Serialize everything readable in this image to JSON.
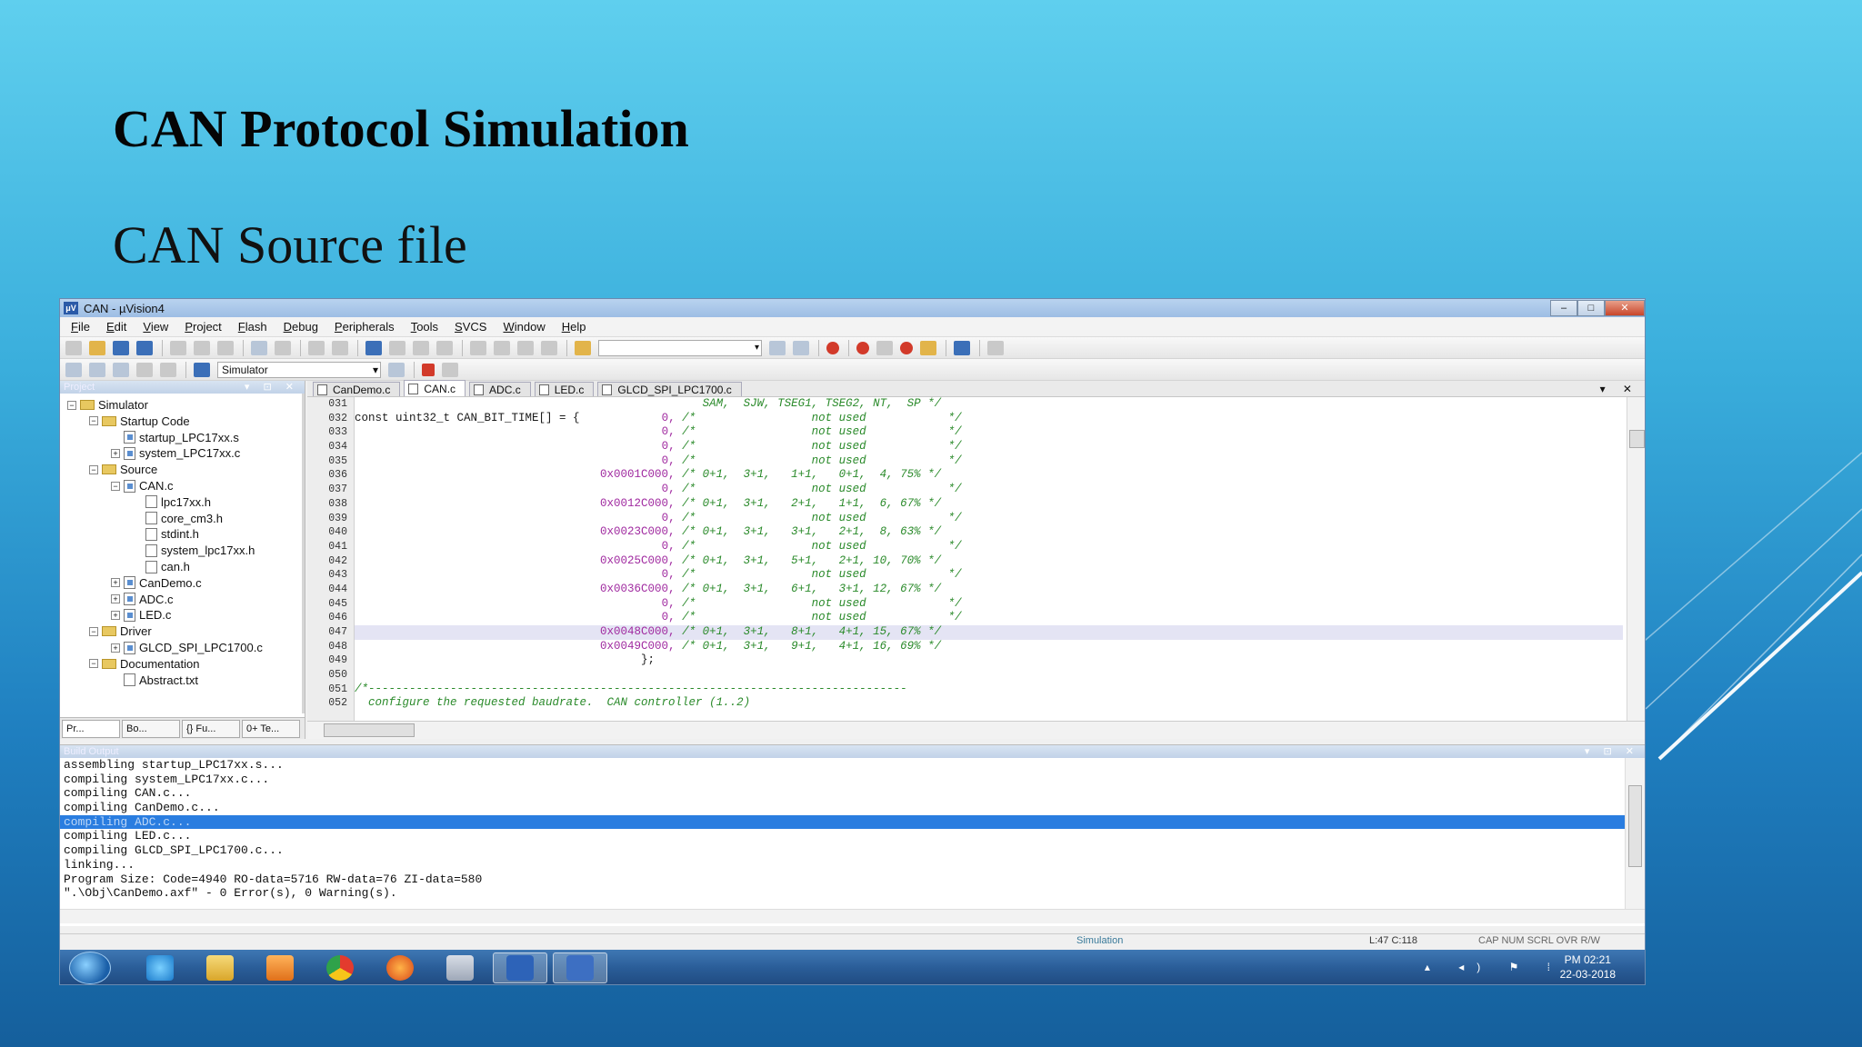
{
  "slide": {
    "title": "CAN Protocol Simulation",
    "subtitle": "CAN Source file"
  },
  "window": {
    "title": "CAN  - µVision4",
    "controls": [
      "–",
      "□",
      "✕"
    ]
  },
  "menu": [
    "File",
    "Edit",
    "View",
    "Project",
    "Flash",
    "Debug",
    "Peripherals",
    "Tools",
    "SVCS",
    "Window",
    "Help"
  ],
  "toolbar": {
    "target": "Simulator"
  },
  "project": {
    "panel_title": "Project",
    "tree": [
      {
        "label": "Simulator",
        "indent": 0,
        "kind": "target",
        "toggle": "−"
      },
      {
        "label": "Startup Code",
        "indent": 1,
        "kind": "folder",
        "toggle": "−"
      },
      {
        "label": "startup_LPC17xx.s",
        "indent": 2,
        "kind": "file",
        "toggle": ""
      },
      {
        "label": "system_LPC17xx.c",
        "indent": 2,
        "kind": "file",
        "toggle": "+"
      },
      {
        "label": "Source",
        "indent": 1,
        "kind": "folder",
        "toggle": "−"
      },
      {
        "label": "CAN.c",
        "indent": 2,
        "kind": "file",
        "toggle": "−"
      },
      {
        "label": "lpc17xx.h",
        "indent": 3,
        "kind": "header",
        "toggle": ""
      },
      {
        "label": "core_cm3.h",
        "indent": 3,
        "kind": "header",
        "toggle": ""
      },
      {
        "label": "stdint.h",
        "indent": 3,
        "kind": "header",
        "toggle": ""
      },
      {
        "label": "system_lpc17xx.h",
        "indent": 3,
        "kind": "header",
        "toggle": ""
      },
      {
        "label": "can.h",
        "indent": 3,
        "kind": "header",
        "toggle": ""
      },
      {
        "label": "CanDemo.c",
        "indent": 2,
        "kind": "file",
        "toggle": "+"
      },
      {
        "label": "ADC.c",
        "indent": 2,
        "kind": "file",
        "toggle": "+"
      },
      {
        "label": "LED.c",
        "indent": 2,
        "kind": "file",
        "toggle": "+"
      },
      {
        "label": "Driver",
        "indent": 1,
        "kind": "folder",
        "toggle": "−"
      },
      {
        "label": "GLCD_SPI_LPC1700.c",
        "indent": 2,
        "kind": "file",
        "toggle": "+"
      },
      {
        "label": "Documentation",
        "indent": 1,
        "kind": "folder",
        "toggle": "−"
      },
      {
        "label": "Abstract.txt",
        "indent": 2,
        "kind": "header",
        "toggle": ""
      }
    ],
    "tabs": [
      "Pr...",
      "Bo...",
      "{} Fu...",
      "0+ Te..."
    ]
  },
  "editor": {
    "tabs": [
      {
        "label": "CanDemo.c",
        "active": false
      },
      {
        "label": "CAN.c",
        "active": true
      },
      {
        "label": "ADC.c",
        "active": false
      },
      {
        "label": "LED.c",
        "active": false
      },
      {
        "label": "GLCD_SPI_LPC1700.c",
        "active": false
      }
    ],
    "lines": [
      {
        "n": "031",
        "parts": [
          {
            "t": "                                                   ",
            "c": "ck"
          },
          {
            "t": "SAM,  SJW, TSEG1, TSEG2, NT,  SP */",
            "c": "cc"
          }
        ]
      },
      {
        "n": "032",
        "parts": [
          {
            "t": "const uint32_t CAN_BIT_TIME[] = {            ",
            "c": "ck"
          },
          {
            "t": "0, ",
            "c": "cn"
          },
          {
            "t": "/*                 not used            */",
            "c": "cc"
          }
        ]
      },
      {
        "n": "033",
        "parts": [
          {
            "t": "                                             ",
            "c": "ck"
          },
          {
            "t": "0, ",
            "c": "cn"
          },
          {
            "t": "/*                 not used            */",
            "c": "cc"
          }
        ]
      },
      {
        "n": "034",
        "parts": [
          {
            "t": "                                             ",
            "c": "ck"
          },
          {
            "t": "0, ",
            "c": "cn"
          },
          {
            "t": "/*                 not used            */",
            "c": "cc"
          }
        ]
      },
      {
        "n": "035",
        "parts": [
          {
            "t": "                                             ",
            "c": "ck"
          },
          {
            "t": "0, ",
            "c": "cn"
          },
          {
            "t": "/*                 not used            */",
            "c": "cc"
          }
        ]
      },
      {
        "n": "036",
        "parts": [
          {
            "t": "                                    ",
            "c": "ck"
          },
          {
            "t": "0x0001C000, ",
            "c": "cn"
          },
          {
            "t": "/* 0+1,  3+1,   1+1,   0+1,  4, 75% */",
            "c": "cc"
          }
        ]
      },
      {
        "n": "037",
        "parts": [
          {
            "t": "                                             ",
            "c": "ck"
          },
          {
            "t": "0, ",
            "c": "cn"
          },
          {
            "t": "/*                 not used            */",
            "c": "cc"
          }
        ]
      },
      {
        "n": "038",
        "parts": [
          {
            "t": "                                    ",
            "c": "ck"
          },
          {
            "t": "0x0012C000, ",
            "c": "cn"
          },
          {
            "t": "/* 0+1,  3+1,   2+1,   1+1,  6, 67% */",
            "c": "cc"
          }
        ]
      },
      {
        "n": "039",
        "parts": [
          {
            "t": "                                             ",
            "c": "ck"
          },
          {
            "t": "0, ",
            "c": "cn"
          },
          {
            "t": "/*                 not used            */",
            "c": "cc"
          }
        ]
      },
      {
        "n": "040",
        "parts": [
          {
            "t": "                                    ",
            "c": "ck"
          },
          {
            "t": "0x0023C000, ",
            "c": "cn"
          },
          {
            "t": "/* 0+1,  3+1,   3+1,   2+1,  8, 63% */",
            "c": "cc"
          }
        ]
      },
      {
        "n": "041",
        "parts": [
          {
            "t": "                                             ",
            "c": "ck"
          },
          {
            "t": "0, ",
            "c": "cn"
          },
          {
            "t": "/*                 not used            */",
            "c": "cc"
          }
        ]
      },
      {
        "n": "042",
        "parts": [
          {
            "t": "                                    ",
            "c": "ck"
          },
          {
            "t": "0x0025C000, ",
            "c": "cn"
          },
          {
            "t": "/* 0+1,  3+1,   5+1,   2+1, 10, 70% */",
            "c": "cc"
          }
        ]
      },
      {
        "n": "043",
        "parts": [
          {
            "t": "                                             ",
            "c": "ck"
          },
          {
            "t": "0, ",
            "c": "cn"
          },
          {
            "t": "/*                 not used            */",
            "c": "cc"
          }
        ]
      },
      {
        "n": "044",
        "parts": [
          {
            "t": "                                    ",
            "c": "ck"
          },
          {
            "t": "0x0036C000, ",
            "c": "cn"
          },
          {
            "t": "/* 0+1,  3+1,   6+1,   3+1, 12, 67% */",
            "c": "cc"
          }
        ]
      },
      {
        "n": "045",
        "parts": [
          {
            "t": "                                             ",
            "c": "ck"
          },
          {
            "t": "0, ",
            "c": "cn"
          },
          {
            "t": "/*                 not used            */",
            "c": "cc"
          }
        ]
      },
      {
        "n": "046",
        "parts": [
          {
            "t": "                                             ",
            "c": "ck"
          },
          {
            "t": "0, ",
            "c": "cn"
          },
          {
            "t": "/*                 not used            */",
            "c": "cc"
          }
        ]
      },
      {
        "n": "047",
        "parts": [
          {
            "t": "                                    ",
            "c": "ck"
          },
          {
            "t": "0x0048C000, ",
            "c": "cn"
          },
          {
            "t": "/* 0+1,  3+1,   8+1,   4+1, 15, 67% */",
            "c": "cc"
          }
        ],
        "hl": true
      },
      {
        "n": "048",
        "parts": [
          {
            "t": "                                    ",
            "c": "ck"
          },
          {
            "t": "0x0049C000, ",
            "c": "cn"
          },
          {
            "t": "/* 0+1,  3+1,   9+1,   4+1, 16, 69% */",
            "c": "cc"
          }
        ]
      },
      {
        "n": "049",
        "parts": [
          {
            "t": "                                          };",
            "c": "ck"
          }
        ]
      },
      {
        "n": "050",
        "parts": [
          {
            "t": "",
            "c": "ck"
          }
        ]
      },
      {
        "n": "051",
        "parts": [
          {
            "t": "/*-------------------------------------------------------------------------------",
            "c": "cc"
          }
        ]
      },
      {
        "n": "052",
        "parts": [
          {
            "t": "  configure the requested baudrate.  CAN controller (1..2)",
            "c": "cc"
          }
        ]
      }
    ]
  },
  "build": {
    "panel_title": "Build Output",
    "lines": [
      "assembling startup_LPC17xx.s...",
      "compiling system_LPC17xx.c...",
      "compiling CAN.c...",
      "compiling CanDemo.c...",
      "compiling ADC.c...",
      "compiling LED.c...",
      "compiling GLCD_SPI_LPC1700.c...",
      "linking...",
      "Program Size: Code=4940 RO-data=5716 RW-data=76 ZI-data=580",
      "\".\\Obj\\CanDemo.axf\" - 0 Error(s), 0 Warning(s)."
    ],
    "selected_index": 4
  },
  "status": {
    "mode": "Simulation",
    "cursor": "L:47 C:118",
    "flags": "CAP  NUM  SCRL  OVR  R/W"
  },
  "taskbar": {
    "apps": [
      "ie-icon",
      "explorer-icon",
      "media-player-icon",
      "chrome-icon",
      "firefox-icon",
      "calculator-icon",
      "uvision-icon",
      "word-icon"
    ],
    "time": "PM 02:21",
    "date": "22-03-2018"
  }
}
